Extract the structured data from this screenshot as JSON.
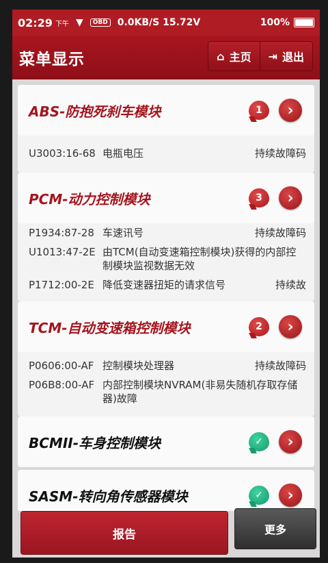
{
  "status_bar": {
    "time": "02:29",
    "ampm": "下午",
    "adapter": "OBD",
    "rate_voltage": "0.0KB/S 15.72V",
    "battery": "100%"
  },
  "header": {
    "title": "菜单显示",
    "home_label": "主页",
    "exit_label": "退出"
  },
  "modules": [
    {
      "name": "ABS-防抱死刹车模块",
      "count": "1",
      "faults": [
        {
          "code": "U3003:16-68",
          "desc": "电瓶电压",
          "status": "持续故障码"
        }
      ]
    },
    {
      "name": "PCM-动力控制模块",
      "count": "3",
      "faults": [
        {
          "code": "P1934:87-28",
          "desc": "车速讯号",
          "status": "持续故障码"
        },
        {
          "code": "U1013:47-2E",
          "desc": "由TCM(自动变速箱控制模块)获得的内部控制模块监视数据无效",
          "status": ""
        },
        {
          "code": "P1712:00-2E",
          "desc": "降低变速器扭矩的请求信号",
          "status": "持续故"
        }
      ]
    },
    {
      "name": "TCM-自动变速箱控制模块",
      "count": "2",
      "faults": [
        {
          "code": "P0606:00-AF",
          "desc": "控制模块处理器",
          "status": "持续故障码"
        },
        {
          "code": "P06B8:00-AF",
          "desc": "内部控制模块NVRAM(非易失随机存取存储器)故障",
          "status": ""
        }
      ]
    },
    {
      "name": "BCMII-车身控制模块",
      "count": "✓",
      "faults": []
    },
    {
      "name": "SASM-转向角传感器模块",
      "count": "✓",
      "faults": []
    }
  ],
  "footer": {
    "report_label": "报告",
    "more_label": "更多"
  },
  "colors": {
    "brand_red": "#a3151e",
    "ok_green": "#1fae7a"
  }
}
